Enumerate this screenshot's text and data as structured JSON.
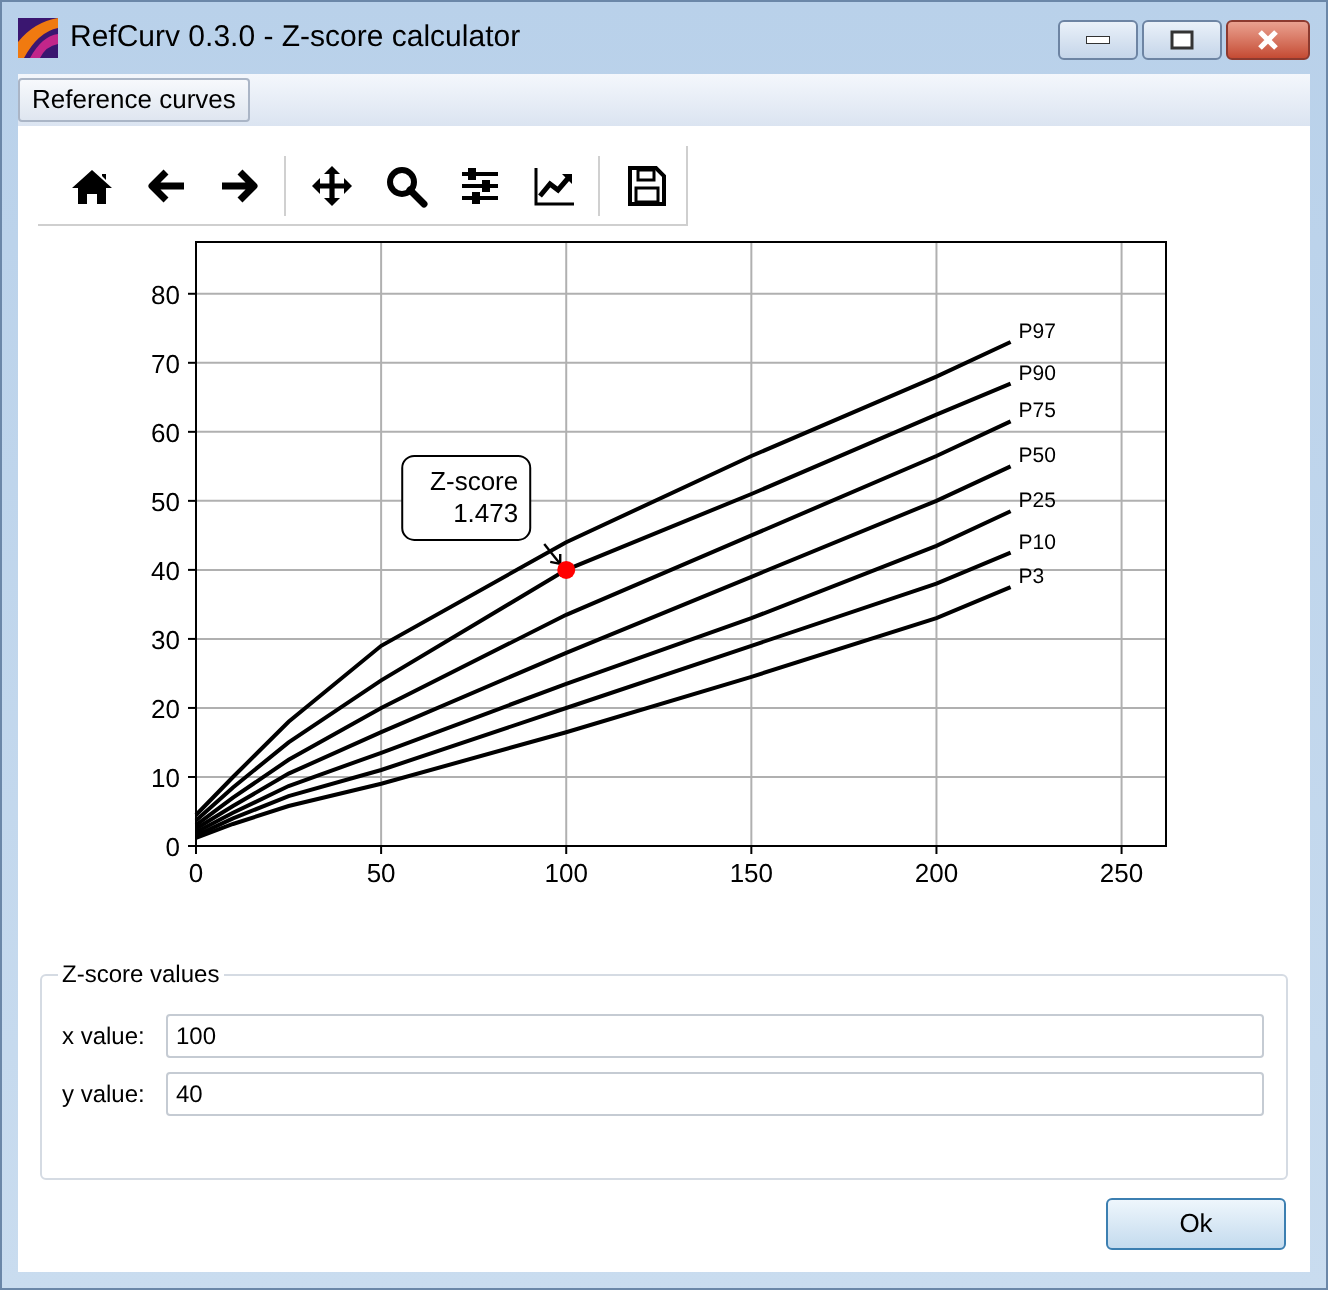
{
  "window": {
    "title": "RefCurv 0.3.0 - Z-score calculator"
  },
  "menu": [
    {
      "label": "Reference curves"
    }
  ],
  "toolbar": [
    [
      {
        "kind": "home"
      },
      {
        "kind": "back"
      },
      {
        "kind": "forward"
      }
    ],
    [
      {
        "kind": "pan"
      },
      {
        "kind": "zoom"
      },
      {
        "kind": "configure"
      },
      {
        "kind": "axes"
      }
    ],
    [
      {
        "kind": "save"
      }
    ]
  ],
  "plot": {
    "chart_data": {
      "type": "line",
      "x": [
        0,
        10,
        25,
        50,
        100,
        150,
        200,
        220
      ],
      "xlim": [
        0,
        262
      ],
      "ylim": [
        0,
        87.5
      ],
      "xticks": [
        0,
        50,
        100,
        150,
        200,
        250
      ],
      "yticks": [
        0,
        10,
        20,
        30,
        40,
        50,
        60,
        70,
        80
      ],
      "series": [
        {
          "name": "P97",
          "color": "#000000",
          "values": [
            4.5,
            10,
            18,
            29,
            44,
            56.5,
            68,
            73
          ]
        },
        {
          "name": "P90",
          "color": "#000000",
          "values": [
            3.7,
            8.5,
            15,
            24,
            40,
            51,
            62.5,
            67
          ]
        },
        {
          "name": "P75",
          "color": "#000000",
          "values": [
            3,
            7,
            12.5,
            20,
            33.5,
            45,
            56.5,
            61.5
          ]
        },
        {
          "name": "P50",
          "color": "#000000",
          "values": [
            2.5,
            5.8,
            10.5,
            16.5,
            28,
            39,
            50,
            55
          ]
        },
        {
          "name": "P25",
          "color": "#000000",
          "values": [
            2,
            4.8,
            8.7,
            13.5,
            23.5,
            33,
            43.5,
            48.5
          ]
        },
        {
          "name": "P10",
          "color": "#000000",
          "values": [
            1.5,
            4,
            7.2,
            11,
            20,
            29,
            38,
            42.5
          ]
        },
        {
          "name": "P3",
          "color": "#000000",
          "values": [
            1.2,
            3.2,
            5.8,
            9,
            16.5,
            24.5,
            33,
            37.5
          ]
        }
      ],
      "grid": true,
      "annotations": [
        {
          "text": "Z-score\n1.473",
          "x": 100,
          "y": 40
        }
      ]
    },
    "marker": {
      "color": "#ff0000"
    }
  },
  "zscore_values": {
    "title": "Z-score values",
    "fields": [
      {
        "label": "x value:",
        "value": "100"
      },
      {
        "label": "y value:",
        "value": "40"
      }
    ]
  },
  "buttons": [
    {
      "label": "Ok"
    }
  ]
}
